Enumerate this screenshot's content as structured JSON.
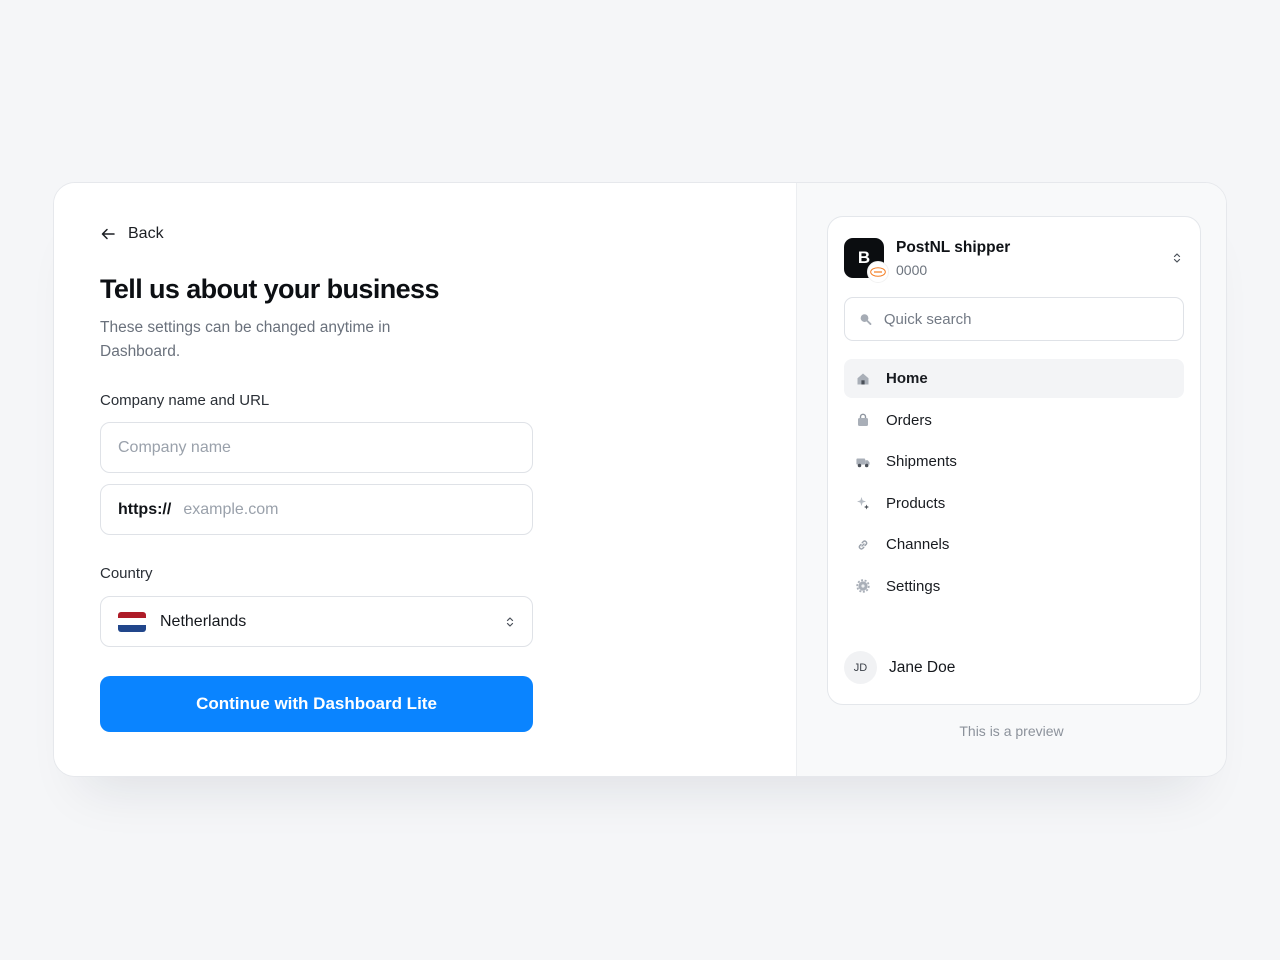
{
  "form": {
    "back_label": "Back",
    "title": "Tell us about your business",
    "subtitle": "These settings can be changed anytime in Dashboard.",
    "company_section_label": "Company name and URL",
    "company_name_value": "",
    "company_name_placeholder": "Company name",
    "url_prefix": "https://",
    "url_value": "",
    "url_placeholder": "example.com",
    "country_label": "Country",
    "country_value": "Netherlands",
    "submit_label": "Continue with Dashboard Lite"
  },
  "preview": {
    "account": {
      "logo_letter": "B",
      "name": "PostNL shipper",
      "id": "0000"
    },
    "search_placeholder": "Quick search",
    "nav": [
      {
        "label": "Home",
        "icon": "home-icon",
        "active": true
      },
      {
        "label": "Orders",
        "icon": "shopping-bag-icon",
        "active": false
      },
      {
        "label": "Shipments",
        "icon": "truck-icon",
        "active": false
      },
      {
        "label": "Products",
        "icon": "sparkle-icon",
        "active": false
      },
      {
        "label": "Channels",
        "icon": "link-icon",
        "active": false
      },
      {
        "label": "Settings",
        "icon": "gear-icon",
        "active": false
      }
    ],
    "user": {
      "initials": "JD",
      "name": "Jane Doe"
    },
    "note": "This is a preview"
  },
  "colors": {
    "primary": "#0a84ff",
    "page_bg": "#f5f6f8",
    "flag_red": "#ae1c28",
    "flag_white": "#ffffff",
    "flag_blue": "#21468b",
    "postnl_orange": "#f47c20"
  }
}
